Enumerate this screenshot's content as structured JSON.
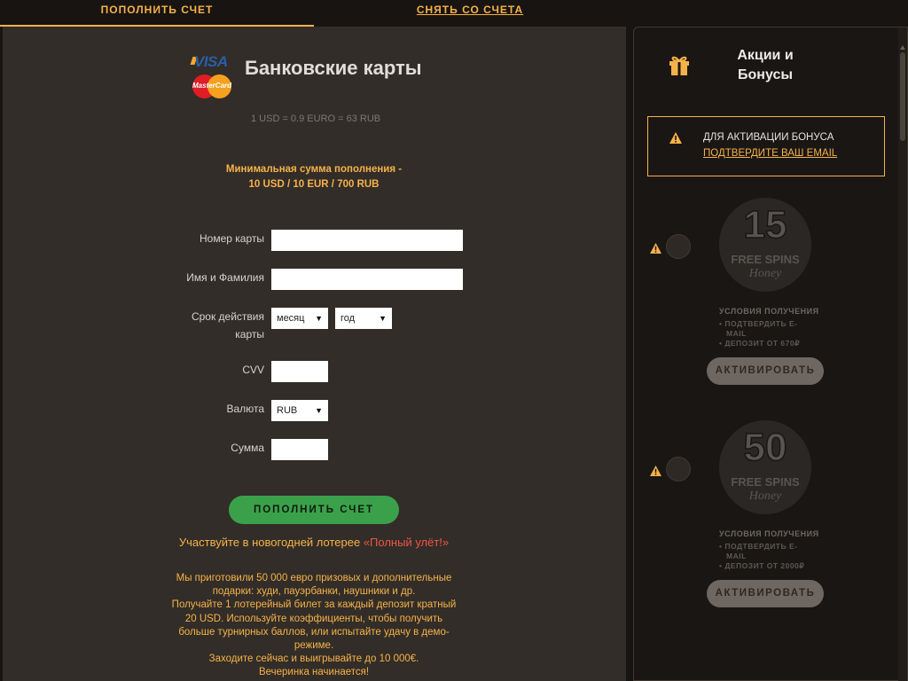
{
  "tabs": {
    "deposit": "ПОПОЛНИТЬ СЧЕТ",
    "withdraw": "СНЯТЬ СО СЧЕТА"
  },
  "payment": {
    "logos": {
      "visa": "VISA",
      "mastercard": "MasterCard"
    },
    "title": "Банковские карты",
    "rate": "1 USD = 0.9 EURO = 63 RUB",
    "min_line1": "Минимальная сумма пополнения -",
    "min_line2": "10 USD / 10 EUR / 700 RUB"
  },
  "form": {
    "card_number_label": "Номер карты",
    "name_label": "Имя и Фамилия",
    "expiry_label_line1": "Срок действия",
    "expiry_label_line2": "карты",
    "month_value": "месяц",
    "year_value": "год",
    "cvv_label": "CVV",
    "currency_label": "Валюта",
    "currency_value": "RUB",
    "amount_label": "Сумма",
    "submit_label": "ПОПОЛНИТЬ СЧЕТ"
  },
  "lottery": {
    "prefix": "Участвуйте в новогодней лотерее ",
    "highlight": "«Полный улёт!»"
  },
  "promo_lines": [
    "Мы приготовили 50 000 евро призовых и дополнительные",
    "подарки: худи, пауэрбанки, наушники и др.",
    "Получайте 1 лотерейный билет за каждый депозит кратный",
    "20 USD. Используйте коэффициенты, чтобы получить",
    "больше турнирных баллов, или испытайте удачу в демо-",
    "режиме.",
    "Заходите сейчас и выигрывайте до 10 000€.",
    "Вечеринка начинается!"
  ],
  "bonuses": {
    "title_line1": "Акции и",
    "title_line2": "Бонусы",
    "notice_line1": "ДЛЯ АКТИВАЦИИ БОНУСА",
    "notice_link": "ПОДТВЕРДИТЕ ВАШ EMAIL",
    "offers": [
      {
        "number": "15",
        "badge_text": "FREE SPINS",
        "brand": "Honey",
        "conditions_title": "УСЛОВИЯ ПОЛУЧЕНИЯ",
        "cond1_line1": "• ПОДТВЕРДИТЬ E-",
        "cond1_line2": "MAIL",
        "cond2": "• ДЕПОЗИТ ОТ 670₽",
        "button": "АКТИВИРОВАТЬ"
      },
      {
        "number": "50",
        "badge_text": "FREE SPINS",
        "brand": "Honey",
        "conditions_title": "УСЛОВИЯ ПОЛУЧЕНИЯ",
        "cond1_line1": "• ПОДТВЕРДИТЬ E-",
        "cond1_line2": "MAIL",
        "cond2": "• ДЕПОЗИТ ОТ 2000₽",
        "button": "АКТИВИРОВАТЬ"
      }
    ]
  },
  "colors": {
    "accent": "#f6b24a",
    "deposit_button": "#3aa14a",
    "lottery_highlight": "#ee5547",
    "panel_bg": "#322d28",
    "sidebar_bg": "#1a1614"
  }
}
